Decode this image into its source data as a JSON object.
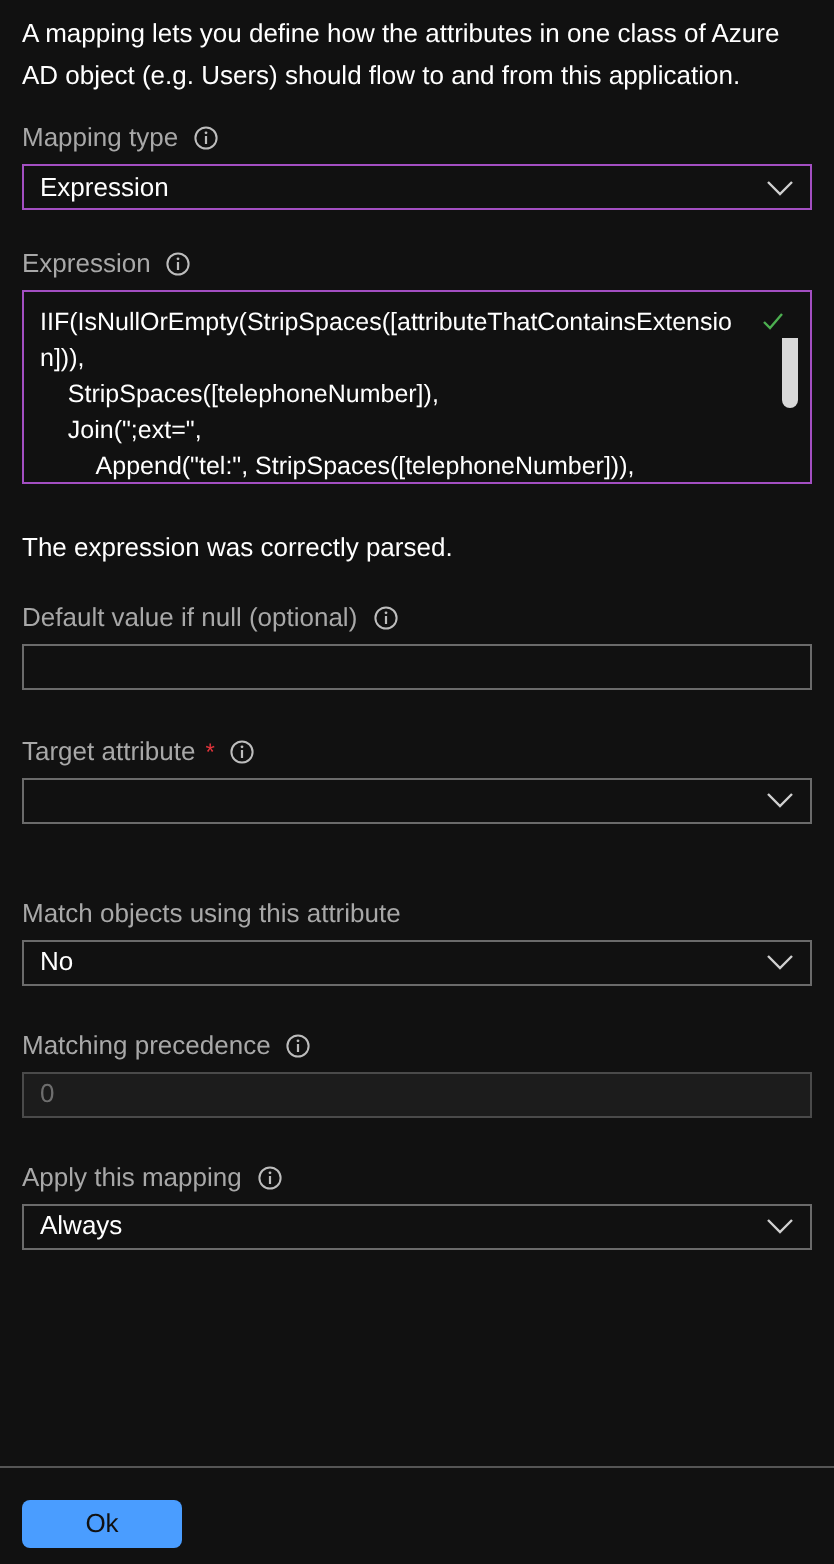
{
  "description": "A mapping lets you define how the attributes in one class of Azure AD object (e.g. Users) should flow to and from this application.",
  "fields": [
    {
      "kind": "dropdown",
      "label": "Mapping type",
      "info": true,
      "value": "Expression",
      "focused": true
    },
    {
      "kind": "expression",
      "label": "Expression",
      "info": true,
      "value": "IIF(IsNullOrEmpty(StripSpaces([attributeThatContainsExtension])),\n    StripSpaces([telephoneNumber]),\n    Join(\";ext=\",\n        Append(\"tel:\", StripSpaces([telephoneNumber])),",
      "focused": true,
      "valid": true,
      "message": "The expression was correctly parsed."
    },
    {
      "kind": "text",
      "label": "Default value if null (optional)",
      "info": true,
      "disabled": false
    },
    {
      "kind": "dropdown",
      "label": "Target attribute",
      "required_mark": "*",
      "info": true,
      "focused": false
    },
    {
      "kind": "dropdown",
      "label": "Match objects using this attribute",
      "value": "No",
      "focused": false
    },
    {
      "kind": "text",
      "label": "Matching precedence",
      "info": true,
      "placeholder": "0",
      "disabled": true
    },
    {
      "kind": "dropdown",
      "label": "Apply this mapping",
      "info": true,
      "value": "Always",
      "focused": false
    }
  ],
  "ok_button": "Ok"
}
